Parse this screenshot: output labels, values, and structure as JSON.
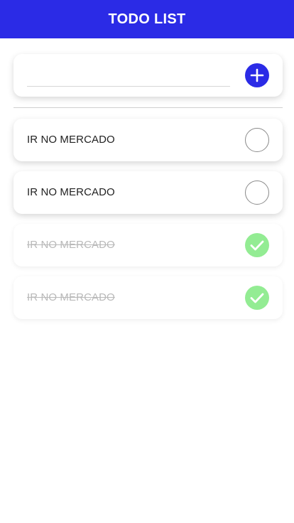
{
  "header": {
    "title": "TODO LIST"
  },
  "new_todo": {
    "value": "",
    "placeholder": ""
  },
  "items": [
    {
      "label": "IR NO MERCADO",
      "done": false
    },
    {
      "label": "IR NO MERCADO",
      "done": false
    },
    {
      "label": "IR NO MERCADO",
      "done": true
    },
    {
      "label": "IR NO MERCADO",
      "done": true
    }
  ],
  "colors": {
    "primary": "#2b2be6",
    "done_check": "#93ec93",
    "done_text": "#b9b9b9"
  },
  "icons": {
    "add": "plus-icon",
    "done": "checkmark-icon",
    "pending": "empty-circle-icon"
  }
}
